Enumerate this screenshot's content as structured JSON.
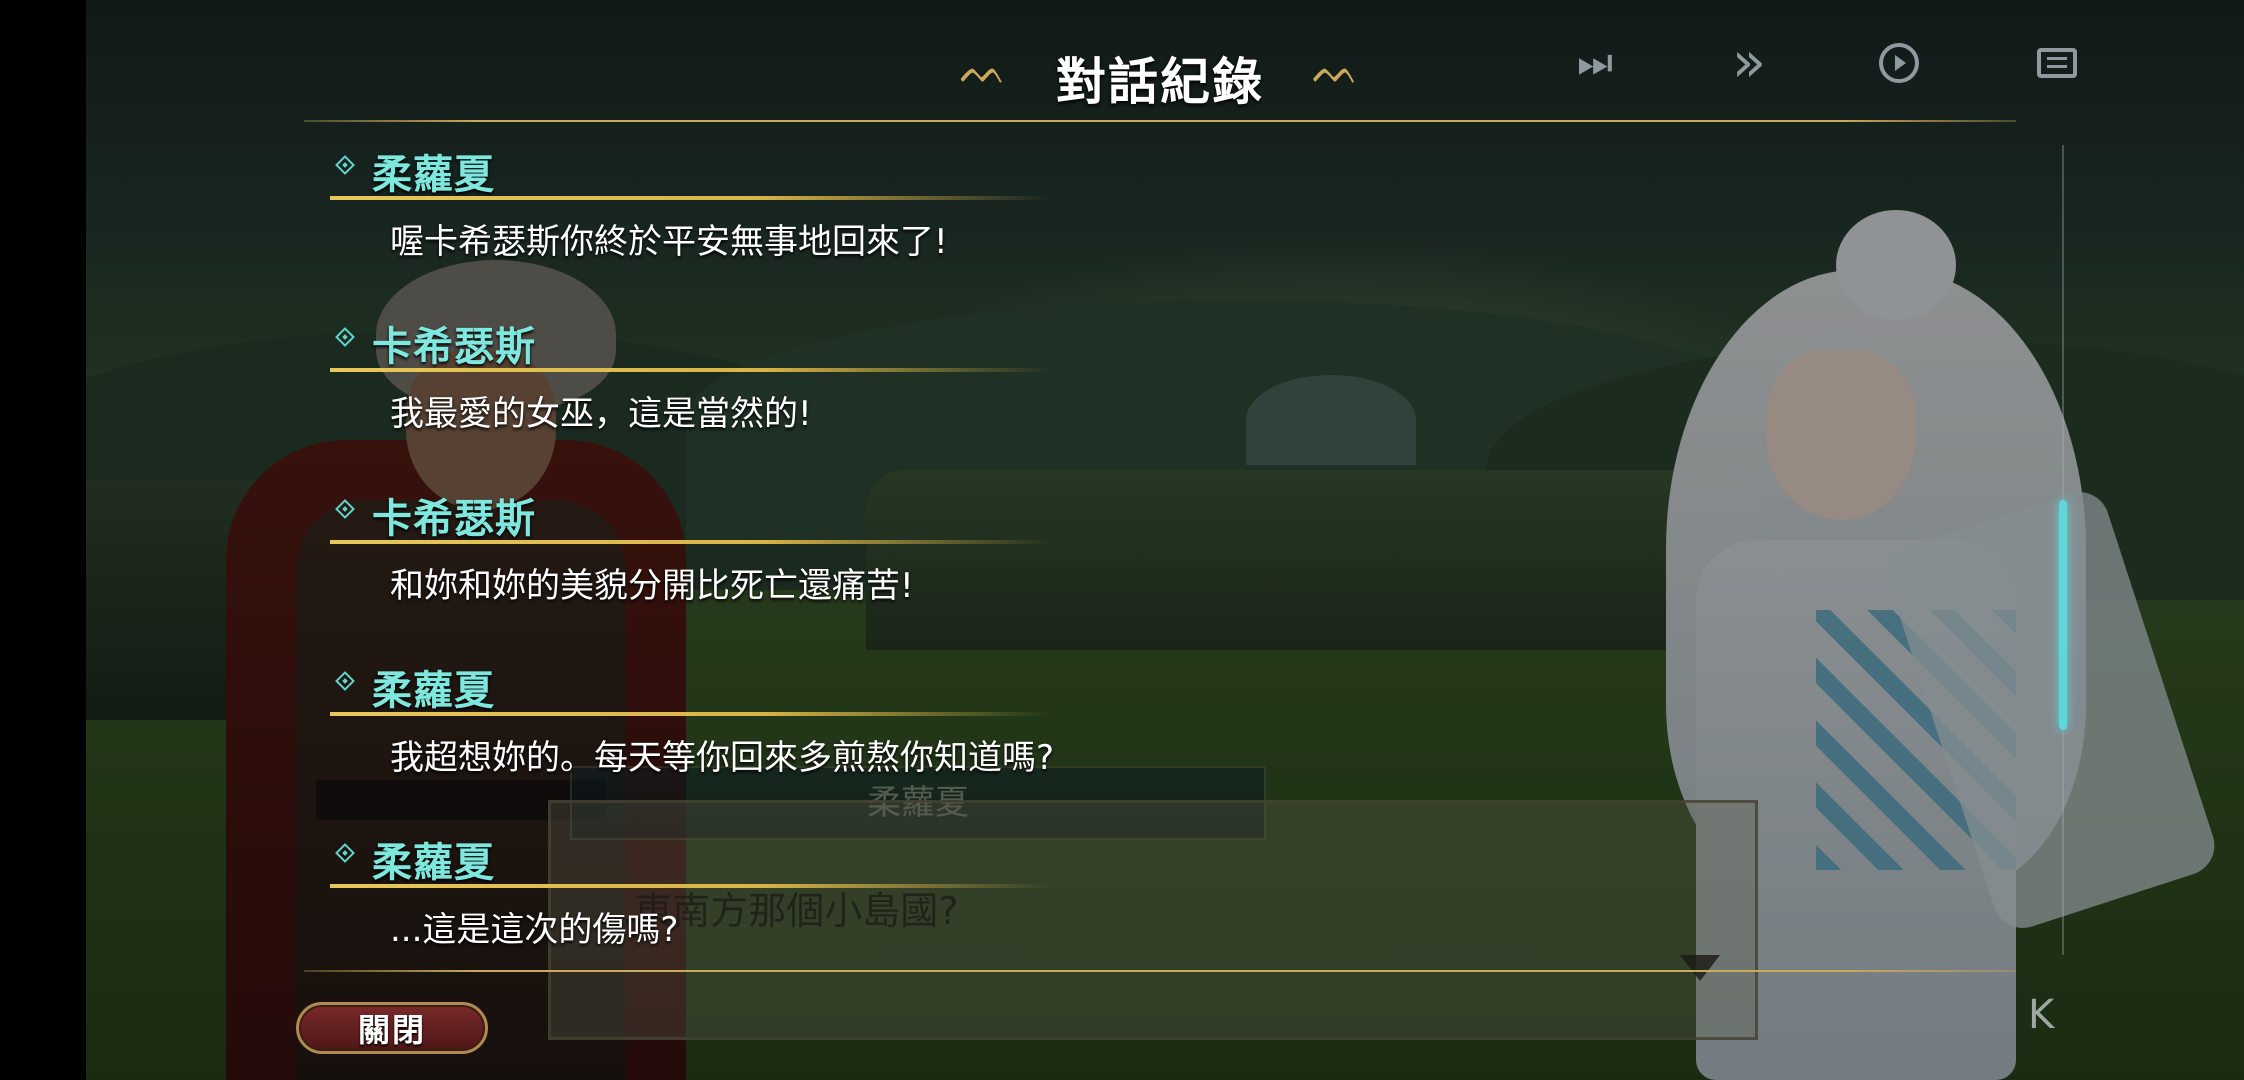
{
  "header": {
    "title": "對話紀錄",
    "flourish_left": "ᨓ",
    "flourish_right": "ᨓ",
    "tools": {
      "skip_glyph": "⏭",
      "fast_forward_glyph": "»",
      "auto_icon": "auto-play-icon",
      "log_icon": "log-icon"
    }
  },
  "log": {
    "entries": [
      {
        "speaker": "柔蘿夏",
        "text": "喔卡希瑟斯你終於平安無事地回來了!"
      },
      {
        "speaker": "卡希瑟斯",
        "text": "我最愛的女巫，這是當然的!"
      },
      {
        "speaker": "卡希瑟斯",
        "text": "和妳和妳的美貌分開比死亡還痛苦!"
      },
      {
        "speaker": "柔蘿夏",
        "text": "我超想妳的。每天等你回來多煎熬你知道嗎?"
      },
      {
        "speaker": "柔蘿夏",
        "text": "...這是這次的傷嗎?"
      }
    ]
  },
  "underlying_dialog": {
    "name": "柔蘿夏",
    "text": "...東南方那個小島國?"
  },
  "close_label": "關閉",
  "corner_glyph": "K",
  "colors": {
    "speaker": "#7fe8de",
    "gold_line": "#e8c85a",
    "scroll_thumb": "#5fd6d8",
    "close_button": "#6a2020"
  }
}
